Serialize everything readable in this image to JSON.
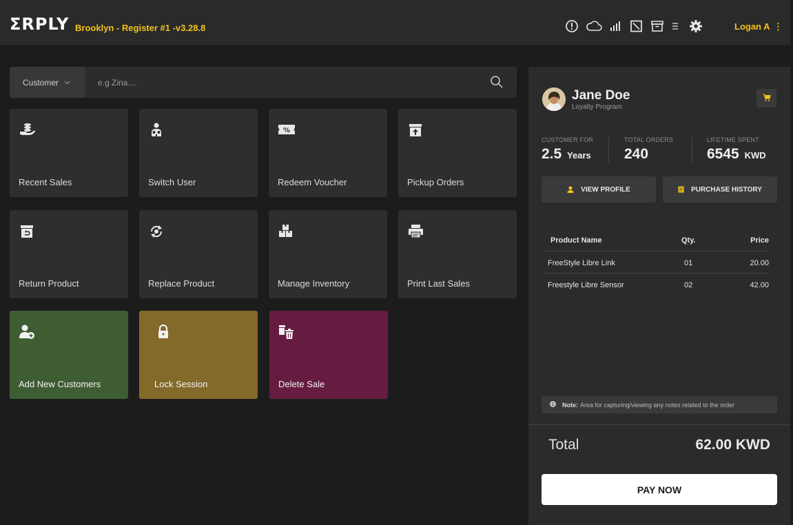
{
  "header": {
    "logo": "ΣRPLY",
    "store_title": "Brooklyn - Register #1 -v3.28.8",
    "icons": [
      "alert-icon",
      "cloud-icon",
      "signal-icon",
      "screen-icon",
      "archive-icon",
      "menu-icon",
      "gear-icon"
    ],
    "user": "Logan A",
    "user_more": "⋮",
    "accent": "#f2c21b"
  },
  "search": {
    "dropdown_label": "Customer",
    "placeholder": "e.g Zina...."
  },
  "tiles": [
    {
      "label": "Recent Sales",
      "icon": "hand-coins-icon"
    },
    {
      "label": "Switch User",
      "icon": "users-switch-icon"
    },
    {
      "label": "Redeem Voucher",
      "icon": "voucher-icon"
    },
    {
      "label": "Pickup Orders",
      "icon": "pickup-box-icon"
    },
    {
      "label": "Return Product",
      "icon": "return-icon"
    },
    {
      "label": "Replace Product",
      "icon": "replace-icon"
    },
    {
      "label": "Manage Inventory",
      "icon": "inventory-icon"
    },
    {
      "label": "Print Last Sales",
      "icon": "printer-icon"
    },
    {
      "label": "Add New Customers",
      "icon": "add-user-icon",
      "color": "#3f5d33"
    },
    {
      "label": "Lock Session",
      "icon": "lock-icon",
      "color": "#836a2b"
    },
    {
      "label": "Delete Sale",
      "icon": "delete-icon",
      "color": "#661c40"
    }
  ],
  "customer": {
    "name": "Jane Doe",
    "program": "Loyalty Program",
    "stats": [
      {
        "label": "CUSTOMER FOR",
        "value": "2.5",
        "unit": "Years"
      },
      {
        "label": "TOTAL ORDERS",
        "value": "240",
        "unit": ""
      },
      {
        "label": "LIFETIME SPENT",
        "value": "6545",
        "unit": "KWD"
      }
    ],
    "view_profile": "VIEW PROFILE",
    "purchase_history": "PURCHASE HISTORY"
  },
  "order": {
    "headers": [
      "Product Name",
      "Qty.",
      "Price"
    ],
    "rows": [
      {
        "name": "FreeStyle Libre Link",
        "qty": "01",
        "price": "20.00"
      },
      {
        "name": "Freestyle Libre Sensor",
        "qty": "02",
        "price": "42.00"
      }
    ],
    "note_label": "Note:",
    "note_text": "Area for capturing/viewing any notes related to the order",
    "total_label": "Total",
    "total_value": "62.00 KWD",
    "pay_label": "PAY NOW"
  }
}
